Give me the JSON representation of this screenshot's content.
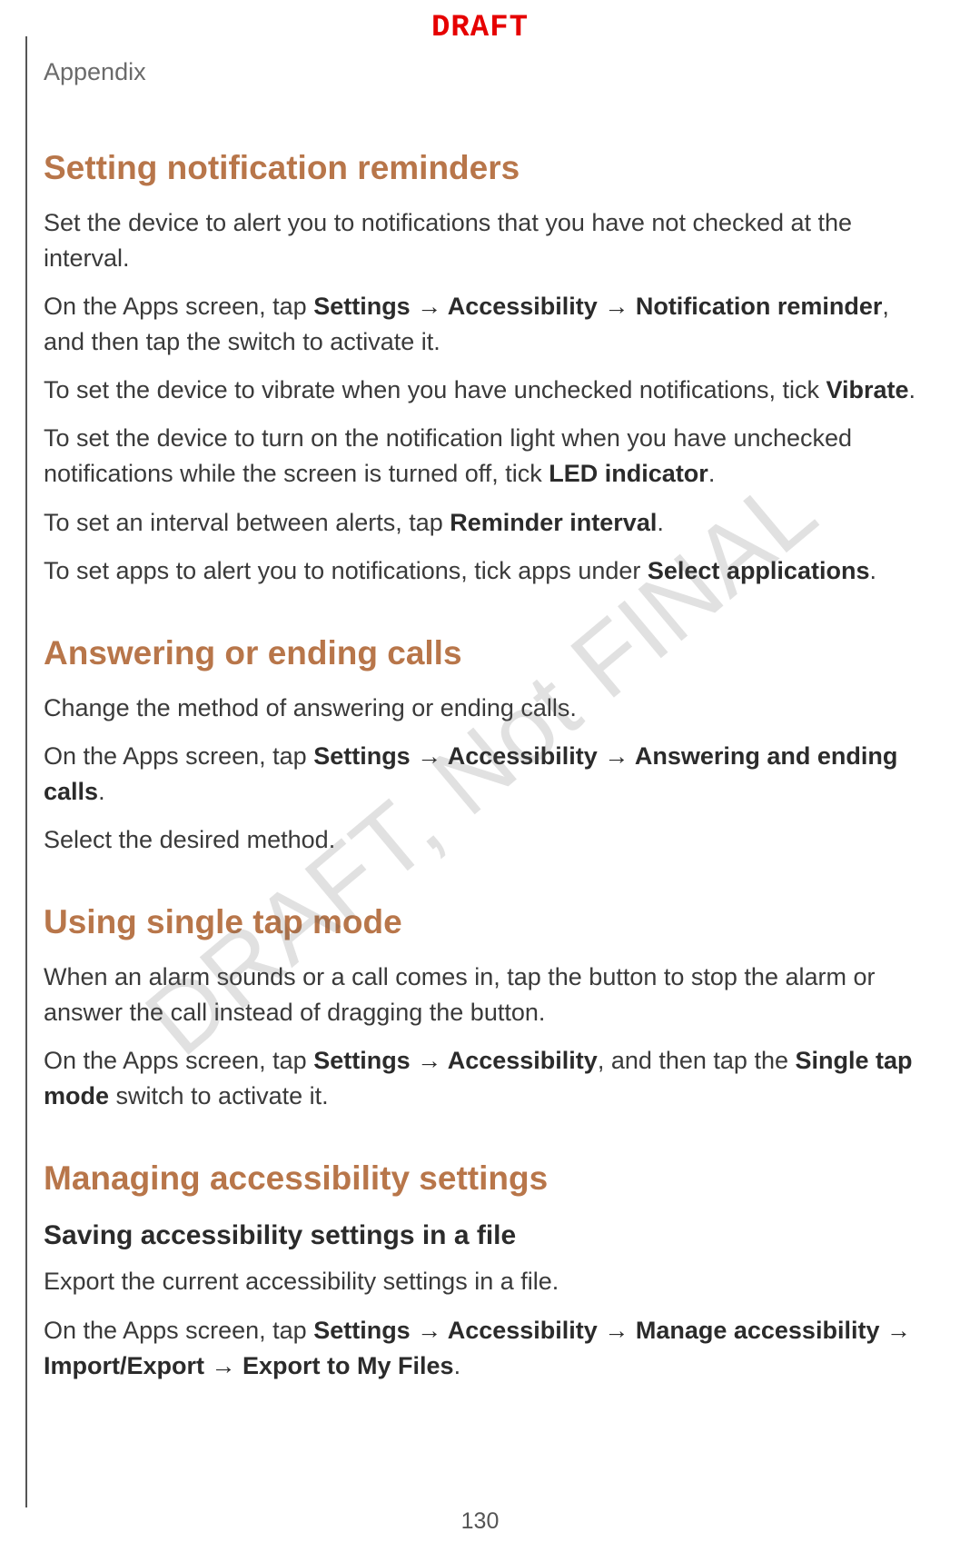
{
  "header": {
    "draft_label": "DRAFT",
    "section_tab": "Appendix"
  },
  "watermark": "DRAFT, Not FINAL",
  "page_number": "130",
  "arrow": " → ",
  "sections": {
    "notif": {
      "title": "Setting notification reminders",
      "p1": "Set the device to alert you to notifications that you have not checked at the interval.",
      "p2": {
        "t0": "On the Apps screen, tap ",
        "b1": "Settings",
        "b2": "Accessibility",
        "b3": "Notification reminder",
        "t4": ", and then tap the switch to activate it."
      },
      "p3": {
        "t0": "To set the device to vibrate when you have unchecked notifications, tick ",
        "b1": "Vibrate",
        "t2": "."
      },
      "p4": {
        "t0": "To set the device to turn on the notification light when you have unchecked notifications while the screen is turned off, tick ",
        "b1": "LED indicator",
        "t2": "."
      },
      "p5": {
        "t0": "To set an interval between alerts, tap ",
        "b1": "Reminder interval",
        "t2": "."
      },
      "p6": {
        "t0": "To set apps to alert you to notifications, tick apps under ",
        "b1": "Select applications",
        "t2": "."
      }
    },
    "calls": {
      "title": "Answering or ending calls",
      "p1": "Change the method of answering or ending calls.",
      "p2": {
        "t0": "On the Apps screen, tap ",
        "b1": "Settings",
        "b2": "Accessibility",
        "b3": "Answering and ending calls",
        "t4": "."
      },
      "p3": "Select the desired method."
    },
    "singletap": {
      "title": "Using single tap mode",
      "p1": "When an alarm sounds or a call comes in, tap the button to stop the alarm or answer the call instead of dragging the button.",
      "p2": {
        "t0": "On the Apps screen, tap ",
        "b1": "Settings",
        "b2": "Accessibility",
        "t3": ", and then tap the ",
        "b4": "Single tap mode",
        "t5": " switch to activate it."
      }
    },
    "managing": {
      "title": "Managing accessibility settings",
      "sub1": {
        "title": "Saving accessibility settings in a file",
        "p1": "Export the current accessibility settings in a file.",
        "p2": {
          "t0": "On the Apps screen, tap ",
          "b1": "Settings",
          "b2": "Accessibility",
          "b3": "Manage accessibility",
          "b4": "Import/Export",
          "b5": "Export to My Files",
          "t6": "."
        }
      }
    }
  }
}
